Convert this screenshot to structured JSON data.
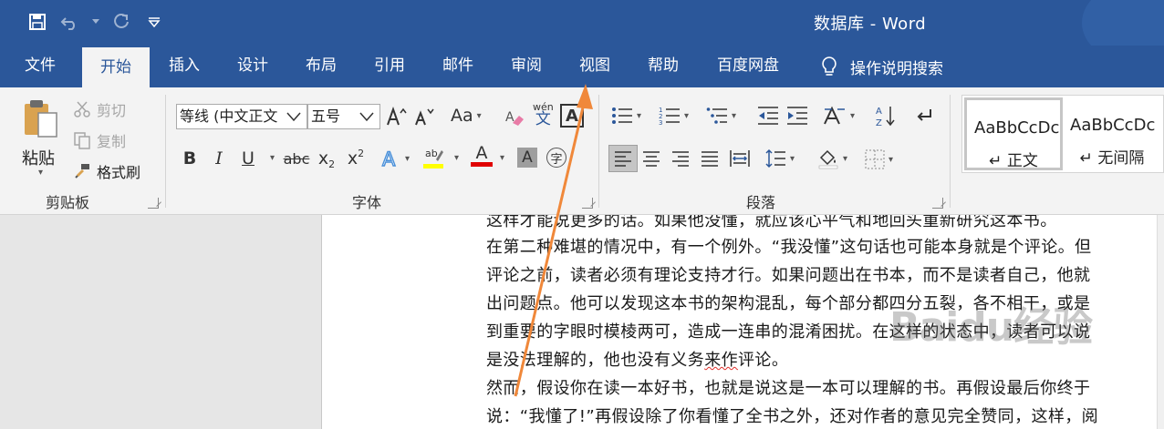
{
  "window": {
    "title": "数据库  -  Word"
  },
  "tabs": [
    {
      "label": "文件"
    },
    {
      "label": "开始"
    },
    {
      "label": "插入"
    },
    {
      "label": "设计"
    },
    {
      "label": "布局"
    },
    {
      "label": "引用"
    },
    {
      "label": "邮件"
    },
    {
      "label": "审阅"
    },
    {
      "label": "视图"
    },
    {
      "label": "帮助"
    },
    {
      "label": "百度网盘"
    }
  ],
  "tell_me": "操作说明搜索",
  "clipboard": {
    "paste": "粘贴",
    "cut": "剪切",
    "copy": "复制",
    "format_painter": "格式刷",
    "group_label": "剪贴板"
  },
  "font": {
    "name": "等线 (中文正文",
    "size": "五号",
    "group_label": "字体",
    "change_case": "Aa",
    "phonetic_top": "wén",
    "phonetic_bottom": "文",
    "border_char": "A",
    "bold": "B",
    "italic": "I",
    "underline": "U",
    "strike": "abc",
    "subscript": "x",
    "superscript": "x",
    "enclose": "字",
    "highlight_color": "#ffff00",
    "font_color": "#e00000"
  },
  "paragraph": {
    "group_label": "段落"
  },
  "styles": [
    {
      "preview": "AaBbCcDc",
      "name": "↵ 正文"
    },
    {
      "preview": "AaBbCcDc",
      "name": "↵ 无间隔"
    }
  ],
  "document": {
    "lines": [
      "这样才能说更多的话。如果他没懂，就应该心平气和地回头重新研究这本书。",
      "在第二种难堪的情况中，有一个例外。“我没懂”这句话也可能本身就是个评论。但",
      "评论之前，读者必须有理论支持才行。如果问题出在书本，而不是读者自己，他就",
      "出问题点。他可以发现这本书的架构混乱，每个部分都四分五裂，各不相干，或是",
      "到重要的字眼时模棱两可，造成一连串的混淆困扰。在这样的状态中，读者可以说",
      "是没法理解的，他也没有义务",
      "然而，假设你在读一本好书，也就是说这是一本可以理解的书。再假设最后你终于",
      "说：“我懂了!”再假设除了你看懂了全书之外，还对作者的意见完全赞同，这样，阅"
    ],
    "squiggle_word": "来作",
    "line6_tail": "评论。"
  },
  "watermark": {
    "text": "Baidu经验"
  },
  "colors": {
    "accent": "#2b579a",
    "arrow": "#f0883a"
  }
}
